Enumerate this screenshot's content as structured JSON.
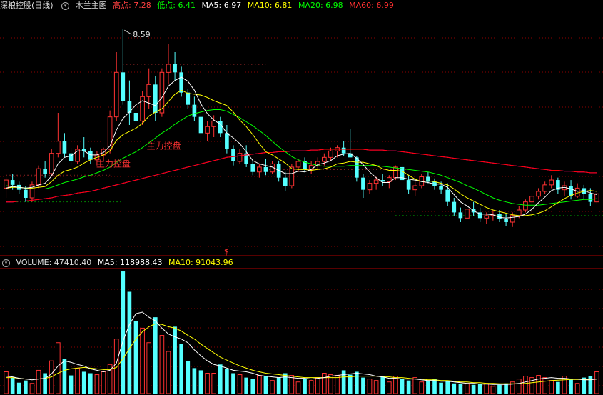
{
  "header": {
    "stock_name": "深粮控股(日线)",
    "indicator": "木兰主图",
    "high_label": "高点: 7.28",
    "low_label": "低点: 6.41",
    "ma5": "MA5: 6.97",
    "ma10": "MA10: 6.81",
    "ma20": "MA20: 6.98",
    "ma60": "MA60: 6.99"
  },
  "volume_header": {
    "volume": "VOLUME: 47410.40",
    "ma5": "MA5: 118988.43",
    "ma10": "MA10: 91043.96"
  },
  "annotations": {
    "peak_label": "8.59",
    "control_label_1": "主力控盘",
    "control_label_2": "主力控盘",
    "marker": "$"
  },
  "colors": {
    "background": "#000000",
    "up": "#ff3232",
    "down": "#54ffff",
    "ma5": "#ffffff",
    "ma10": "#ffff00",
    "ma20": "#00ff00",
    "ma60": "#ff0000",
    "ma120": "#ff00ff",
    "grid": "#8b0000"
  },
  "icons": {
    "collapse": "chevron-down-icon"
  },
  "chart_data": [
    {
      "type": "candlestick",
      "title": "深粮控股(日线) 木兰主图",
      "y_range": [
        5.9,
        8.75
      ],
      "grid": "dotted-horizontal",
      "ohlc": [
        [
          6.62,
          6.78,
          6.5,
          6.72
        ],
        [
          6.72,
          6.8,
          6.6,
          6.66
        ],
        [
          6.66,
          6.7,
          6.55,
          6.6
        ],
        [
          6.6,
          6.65,
          6.45,
          6.5
        ],
        [
          6.5,
          6.7,
          6.45,
          6.66
        ],
        [
          6.66,
          6.9,
          6.62,
          6.86
        ],
        [
          6.86,
          6.95,
          6.75,
          6.8
        ],
        [
          6.8,
          7.1,
          6.78,
          7.05
        ],
        [
          7.05,
          7.55,
          7.0,
          7.2
        ],
        [
          7.2,
          7.3,
          7.0,
          7.05
        ],
        [
          7.05,
          7.12,
          6.9,
          6.95
        ],
        [
          6.95,
          7.15,
          6.92,
          7.1
        ],
        [
          7.1,
          7.25,
          7.0,
          7.08
        ],
        [
          7.08,
          7.12,
          6.92,
          6.97
        ],
        [
          6.97,
          7.08,
          6.9,
          7.03
        ],
        [
          7.03,
          7.12,
          6.95,
          7.1
        ],
        [
          7.1,
          7.58,
          7.05,
          7.5
        ],
        [
          7.5,
          8.3,
          7.45,
          8.05
        ],
        [
          8.05,
          8.59,
          7.65,
          7.7
        ],
        [
          7.7,
          7.95,
          7.4,
          7.55
        ],
        [
          7.55,
          7.65,
          7.35,
          7.45
        ],
        [
          7.45,
          7.82,
          7.4,
          7.75
        ],
        [
          7.75,
          8.1,
          7.6,
          7.9
        ],
        [
          7.9,
          8.0,
          7.45,
          7.55
        ],
        [
          7.55,
          8.1,
          7.5,
          8.05
        ],
        [
          8.05,
          8.4,
          7.9,
          8.15
        ],
        [
          8.15,
          8.3,
          7.95,
          8.05
        ],
        [
          8.05,
          8.12,
          7.75,
          7.8
        ],
        [
          7.8,
          7.85,
          7.6,
          7.65
        ],
        [
          7.65,
          7.75,
          7.45,
          7.5
        ],
        [
          7.5,
          7.7,
          7.2,
          7.3
        ],
        [
          7.3,
          7.45,
          7.2,
          7.38
        ],
        [
          7.38,
          7.52,
          7.25,
          7.45
        ],
        [
          7.45,
          7.5,
          7.25,
          7.3
        ],
        [
          7.3,
          7.4,
          7.05,
          7.1
        ],
        [
          7.1,
          7.15,
          6.9,
          6.95
        ],
        [
          6.95,
          7.1,
          6.92,
          7.05
        ],
        [
          7.05,
          7.15,
          6.88,
          6.92
        ],
        [
          6.92,
          6.98,
          6.78,
          6.82
        ],
        [
          6.82,
          6.92,
          6.75,
          6.88
        ],
        [
          6.88,
          6.98,
          6.78,
          6.82
        ],
        [
          6.82,
          6.95,
          6.8,
          6.92
        ],
        [
          6.92,
          6.96,
          6.7,
          6.75
        ],
        [
          6.75,
          6.82,
          6.58,
          6.65
        ],
        [
          6.65,
          6.92,
          6.62,
          6.88
        ],
        [
          6.88,
          6.98,
          6.82,
          6.95
        ],
        [
          6.95,
          7.0,
          6.82,
          6.85
        ],
        [
          6.85,
          6.95,
          6.8,
          6.9
        ],
        [
          6.9,
          7.0,
          6.85,
          6.95
        ],
        [
          6.95,
          7.05,
          6.9,
          7.0
        ],
        [
          7.0,
          7.12,
          6.95,
          7.08
        ],
        [
          7.08,
          7.15,
          7.0,
          7.12
        ],
        [
          7.12,
          7.2,
          7.02,
          7.05
        ],
        [
          7.05,
          7.35,
          7.0,
          7.0
        ],
        [
          7.0,
          7.02,
          6.7,
          6.75
        ],
        [
          6.75,
          6.8,
          6.5,
          6.6
        ],
        [
          6.6,
          6.72,
          6.55,
          6.68
        ],
        [
          6.68,
          6.76,
          6.6,
          6.72
        ],
        [
          6.72,
          6.8,
          6.65,
          6.7
        ],
        [
          6.7,
          6.78,
          6.62,
          6.75
        ],
        [
          6.75,
          6.9,
          6.72,
          6.88
        ],
        [
          6.88,
          6.92,
          6.7,
          6.72
        ],
        [
          6.72,
          6.78,
          6.55,
          6.6
        ],
        [
          6.6,
          6.7,
          6.52,
          6.65
        ],
        [
          6.65,
          6.8,
          6.62,
          6.76
        ],
        [
          6.76,
          6.82,
          6.68,
          6.7
        ],
        [
          6.7,
          6.74,
          6.6,
          6.65
        ],
        [
          6.65,
          6.7,
          6.55,
          6.6
        ],
        [
          6.6,
          6.68,
          6.4,
          6.45
        ],
        [
          6.45,
          6.5,
          6.28,
          6.32
        ],
        [
          6.32,
          6.38,
          6.2,
          6.25
        ],
        [
          6.25,
          6.4,
          6.2,
          6.36
        ],
        [
          6.36,
          6.45,
          6.28,
          6.32
        ],
        [
          6.32,
          6.38,
          6.2,
          6.25
        ],
        [
          6.25,
          6.32,
          6.18,
          6.28
        ],
        [
          6.28,
          6.35,
          6.22,
          6.3
        ],
        [
          6.3,
          6.35,
          6.2,
          6.24
        ],
        [
          6.24,
          6.3,
          6.15,
          6.2
        ],
        [
          6.2,
          6.32,
          6.14,
          6.28
        ],
        [
          6.28,
          6.4,
          6.25,
          6.35
        ],
        [
          6.35,
          6.48,
          6.32,
          6.45
        ],
        [
          6.45,
          6.55,
          6.4,
          6.52
        ],
        [
          6.52,
          6.62,
          6.48,
          6.58
        ],
        [
          6.58,
          6.7,
          6.55,
          6.66
        ],
        [
          6.66,
          6.78,
          6.62,
          6.72
        ],
        [
          6.72,
          6.75,
          6.55,
          6.6
        ],
        [
          6.6,
          6.7,
          6.52,
          6.65
        ],
        [
          6.65,
          6.72,
          6.48,
          6.52
        ],
        [
          6.52,
          6.68,
          6.5,
          6.62
        ],
        [
          6.62,
          6.66,
          6.48,
          6.55
        ],
        [
          6.55,
          6.62,
          6.4,
          6.45
        ],
        [
          6.45,
          6.58,
          6.42,
          6.55
        ]
      ],
      "ma5": [
        6.62,
        6.64,
        6.63,
        6.62,
        6.63,
        6.66,
        6.68,
        6.77,
        6.92,
        7.0,
        7.02,
        7.08,
        7.08,
        7.03,
        7.03,
        7.06,
        7.14,
        7.34,
        7.48,
        7.56,
        7.65,
        7.7,
        7.67,
        7.64,
        7.74,
        7.88,
        7.95,
        7.99,
        7.94,
        7.83,
        7.66,
        7.54,
        7.46,
        7.41,
        7.3,
        7.24,
        7.17,
        7.07,
        6.96,
        6.92,
        6.9,
        6.88,
        6.84,
        6.8,
        6.8,
        6.83,
        6.82,
        6.85,
        6.91,
        6.93,
        6.96,
        7.02,
        7.04,
        7.05,
        6.99,
        6.91,
        6.82,
        6.75,
        6.69,
        6.69,
        6.75,
        6.75,
        6.73,
        6.72,
        6.7,
        6.69,
        6.67,
        6.67,
        6.63,
        6.54,
        6.45,
        6.4,
        6.34,
        6.3,
        6.3,
        6.29,
        6.26,
        6.25,
        6.26,
        6.27,
        6.3,
        6.36,
        6.44,
        6.51,
        6.59,
        6.62,
        6.63,
        6.61,
        6.58,
        6.59,
        6.56,
        6.54
      ],
      "ma10": [
        6.62,
        6.63,
        6.63,
        6.62,
        6.62,
        6.63,
        6.64,
        6.7,
        6.78,
        6.83,
        6.85,
        6.88,
        6.93,
        6.97,
        7.0,
        7.03,
        7.08,
        7.21,
        7.28,
        7.32,
        7.36,
        7.42,
        7.51,
        7.56,
        7.6,
        7.69,
        7.78,
        7.83,
        7.79,
        7.78,
        7.77,
        7.74,
        7.7,
        7.67,
        7.64,
        7.56,
        7.46,
        7.38,
        7.28,
        7.17,
        7.07,
        7.03,
        6.98,
        6.93,
        6.86,
        6.85,
        6.85,
        6.84,
        6.85,
        6.86,
        6.88,
        6.92,
        6.93,
        6.95,
        6.94,
        6.94,
        6.92,
        6.9,
        6.86,
        6.84,
        6.84,
        6.83,
        6.78,
        6.73,
        6.7,
        6.71,
        6.7,
        6.68,
        6.66,
        6.61,
        6.55,
        6.5,
        6.46,
        6.42,
        6.38,
        6.35,
        6.33,
        6.31,
        6.29,
        6.28,
        6.28,
        6.29,
        6.31,
        6.34,
        6.39,
        6.44,
        6.49,
        6.53,
        6.56,
        6.58,
        6.59,
        6.58
      ],
      "ma20": [
        6.65,
        6.64,
        6.63,
        6.62,
        6.61,
        6.61,
        6.61,
        6.63,
        6.66,
        6.69,
        6.71,
        6.73,
        6.76,
        6.78,
        6.81,
        6.84,
        6.88,
        6.94,
        6.99,
        7.03,
        7.07,
        7.12,
        7.18,
        7.24,
        7.3,
        7.35,
        7.41,
        7.46,
        7.51,
        7.54,
        7.56,
        7.58,
        7.59,
        7.59,
        7.57,
        7.53,
        7.49,
        7.44,
        7.39,
        7.33,
        7.27,
        7.2,
        7.13,
        7.07,
        7.01,
        6.97,
        6.94,
        6.92,
        6.9,
        6.89,
        6.89,
        6.89,
        6.89,
        6.9,
        6.9,
        6.9,
        6.9,
        6.9,
        6.89,
        6.88,
        6.87,
        6.86,
        6.85,
        6.84,
        6.83,
        6.82,
        6.8,
        6.78,
        6.75,
        6.72,
        6.69,
        6.65,
        6.62,
        6.58,
        6.54,
        6.5,
        6.47,
        6.45,
        6.43,
        6.42,
        6.41,
        6.41,
        6.41,
        6.42,
        6.43,
        6.44,
        6.45,
        6.46,
        6.47,
        6.48,
        6.48,
        6.49
      ],
      "ma60": [
        6.45,
        6.45,
        6.46,
        6.46,
        6.47,
        6.48,
        6.49,
        6.5,
        6.52,
        6.53,
        6.54,
        6.56,
        6.57,
        6.58,
        6.6,
        6.62,
        6.64,
        6.66,
        6.68,
        6.7,
        6.72,
        6.74,
        6.76,
        6.78,
        6.8,
        6.82,
        6.84,
        6.86,
        6.88,
        6.9,
        6.92,
        6.94,
        6.96,
        6.98,
        7.0,
        7.01,
        7.02,
        7.03,
        7.04,
        7.05,
        7.06,
        7.06,
        7.07,
        7.07,
        7.08,
        7.08,
        7.08,
        7.09,
        7.09,
        7.1,
        7.1,
        7.1,
        7.1,
        7.1,
        7.1,
        7.1,
        7.09,
        7.09,
        7.09,
        7.08,
        7.08,
        7.07,
        7.06,
        7.05,
        7.04,
        7.03,
        7.02,
        7.01,
        7.0,
        6.99,
        6.98,
        6.97,
        6.96,
        6.95,
        6.94,
        6.93,
        6.92,
        6.91,
        6.9,
        6.89,
        6.88,
        6.87,
        6.86,
        6.85,
        6.84,
        6.84,
        6.83,
        6.83,
        6.82,
        6.82,
        6.81,
        6.81
      ],
      "ma120": [
        6.45,
        6.45,
        6.46,
        6.46,
        6.47,
        6.48,
        6.49,
        6.5,
        6.52,
        6.53,
        6.54,
        6.56,
        6.57,
        6.58,
        6.6,
        6.62,
        6.64,
        6.66,
        6.68,
        6.7,
        6.72,
        6.74,
        6.76,
        6.78,
        6.8,
        6.82,
        6.84,
        6.86,
        6.88,
        6.9,
        6.92,
        6.94,
        6.96,
        6.98,
        7.0,
        7.01,
        7.02,
        7.03,
        7.04,
        7.05,
        7.06,
        7.06,
        7.07,
        7.07,
        7.08,
        7.08,
        7.08,
        7.09,
        7.09,
        7.1,
        7.1,
        7.1,
        7.1,
        7.1,
        7.1,
        7.1,
        7.09,
        7.09,
        7.09,
        7.08,
        7.08,
        7.07,
        7.06,
        7.05,
        7.04,
        7.03,
        7.02,
        7.01,
        7.0,
        6.99,
        6.98,
        6.97,
        6.96,
        6.95,
        6.94,
        6.93,
        6.92,
        6.91,
        6.9,
        6.89,
        6.88,
        6.87,
        6.86,
        6.85,
        6.84,
        6.84,
        6.83,
        6.83,
        6.82,
        6.82,
        6.81,
        6.81
      ]
    },
    {
      "type": "bar",
      "title": "VOLUME",
      "y_range": [
        0,
        170000
      ],
      "volume": [
        30000,
        22000,
        15000,
        18000,
        14000,
        32000,
        28000,
        45000,
        70000,
        48000,
        25000,
        35000,
        30000,
        28000,
        26000,
        30000,
        40000,
        75000,
        168000,
        140000,
        100000,
        90000,
        70000,
        105000,
        80000,
        58000,
        92000,
        68000,
        45000,
        35000,
        32000,
        28000,
        28000,
        40000,
        34000,
        28000,
        26000,
        22000,
        20000,
        25000,
        24000,
        18000,
        22000,
        28000,
        25000,
        16000,
        20000,
        18000,
        22000,
        28000,
        26000,
        25000,
        32000,
        26000,
        30000,
        22000,
        20000,
        18000,
        24000,
        16000,
        24000,
        20000,
        18000,
        22000,
        16000,
        18000,
        20000,
        15000,
        18000,
        14000,
        13000,
        14000,
        12000,
        13000,
        14000,
        10000,
        12000,
        14000,
        16000,
        20000,
        24000,
        22000,
        25000,
        22000,
        18000,
        16000,
        24000,
        20000,
        14000,
        22000,
        24000,
        30000
      ],
      "ma5_vol": [
        24000,
        23000,
        21000,
        20000,
        19000,
        20000,
        21000,
        27000,
        38000,
        45000,
        43000,
        40000,
        38000,
        34000,
        32000,
        30000,
        32000,
        42000,
        72000,
        95000,
        110000,
        112000,
        105000,
        100000,
        90000,
        82000,
        78000,
        75000,
        70000,
        60000,
        52000,
        45000,
        40000,
        38000,
        35000,
        32000,
        31000,
        30000,
        28000,
        25000,
        24000,
        23000,
        22000,
        23000,
        22000,
        21000,
        21000,
        20000,
        21000,
        22000,
        24000,
        25000,
        26000,
        27000,
        28000,
        27000,
        26000,
        24000,
        23000,
        21000,
        21000,
        20000,
        20000,
        20000,
        19000,
        18000,
        18000,
        17000,
        17000,
        16000,
        15000,
        14000,
        14000,
        13000,
        13000,
        12500,
        12500,
        12500,
        13000,
        14000,
        16000,
        18000,
        20000,
        21000,
        22000,
        21000,
        21000,
        20000,
        20000,
        19000,
        19000,
        20000
      ],
      "ma10_vol": [
        22000,
        22000,
        21000,
        20000,
        20000,
        20000,
        21000,
        23000,
        28000,
        32000,
        34000,
        35000,
        36000,
        35000,
        34000,
        33000,
        33000,
        36000,
        48000,
        62000,
        75000,
        85000,
        92000,
        96000,
        95000,
        92000,
        90000,
        86000,
        80000,
        75000,
        68000,
        62000,
        56000,
        50000,
        46000,
        42000,
        38000,
        35000,
        32000,
        30000,
        28000,
        27000,
        26000,
        25000,
        24000,
        23000,
        22000,
        22000,
        22000,
        22000,
        22000,
        22000,
        23000,
        23000,
        24000,
        24000,
        24000,
        24000,
        23000,
        23000,
        22000,
        22000,
        21000,
        20000,
        20000,
        19000,
        19000,
        18000,
        18000,
        17000,
        16000,
        16000,
        15000,
        15000,
        14000,
        14000,
        13500,
        13500,
        13500,
        13500,
        14000,
        15000,
        16000,
        17000,
        18000,
        18500,
        19000,
        19500,
        19500,
        19500,
        19500,
        20000
      ]
    }
  ]
}
